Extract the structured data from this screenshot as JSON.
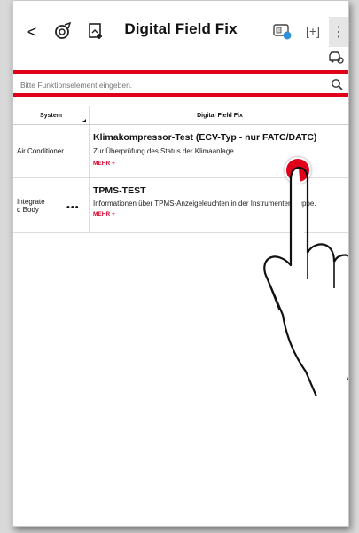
{
  "header": {
    "title": "Digital Field Fix",
    "back_glyph": "<",
    "menu_glyph": "⋮",
    "scan_glyph": "[+]"
  },
  "search": {
    "placeholder": "Bitte Funktionselement eingeben."
  },
  "table": {
    "columns": [
      "System",
      "Digital Field Fix"
    ],
    "rows": [
      {
        "system": "Air Conditioner",
        "title": "Klimakompressor-Test (ECV-Typ - nur FATC/DATC)",
        "description": "Zur Überprüfung des Status der Klimaanlage.",
        "more": "MEHR +"
      },
      {
        "system": "Integrate d Body",
        "system_line1": "Integrate",
        "system_line2": "d Body",
        "system_dots": "•••",
        "title": "TPMS-TEST",
        "description": "Informationen über TPMS-Anzeigeleuchten in der Instrumentengruppe.",
        "more": "MEHR +"
      }
    ]
  },
  "colors": {
    "accent": "#e0001a",
    "more_link": "#d4002a"
  },
  "icons": [
    "back-icon",
    "vehicle-scan-icon",
    "add-document-icon",
    "vci-device-icon",
    "screen-capture-icon",
    "more-menu-icon",
    "car-settings-icon",
    "search-icon",
    "hand-pointer-icon"
  ]
}
